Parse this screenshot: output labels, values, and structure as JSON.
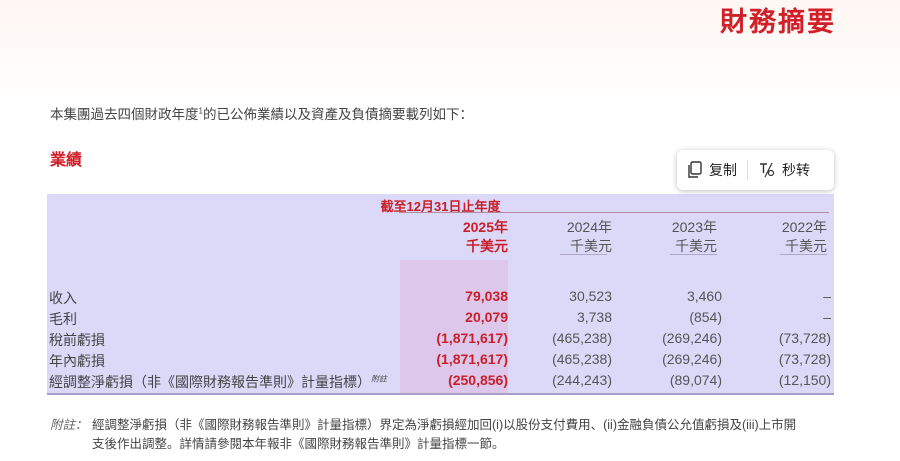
{
  "header": {
    "title": "財務摘要"
  },
  "intro": {
    "text_before": "本集團過去四個財政年度",
    "sup": "1",
    "text_after": "的已公佈業績以及資產及負債摘要載列如下："
  },
  "section": {
    "title": "業績"
  },
  "toolbar": {
    "copy_label": "复制",
    "convert_label": "秒转"
  },
  "table": {
    "period_header": "截至12月31日止年度",
    "columns": [
      {
        "year": "2025年",
        "unit": "千美元"
      },
      {
        "year": "2024年",
        "unit": "千美元"
      },
      {
        "year": "2023年",
        "unit": "千美元"
      },
      {
        "year": "2022年",
        "unit": "千美元"
      }
    ],
    "rows": [
      {
        "label": "收入",
        "values": [
          "79,038",
          "30,523",
          "3,460",
          "–"
        ]
      },
      {
        "label": "毛利",
        "values": [
          "20,079",
          "3,738",
          "(854)",
          "–"
        ]
      },
      {
        "label": "稅前虧損",
        "values": [
          "(1,871,617)",
          "(465,238)",
          "(269,246)",
          "(73,728)"
        ]
      },
      {
        "label": "年內虧損",
        "values": [
          "(1,871,617)",
          "(465,238)",
          "(269,246)",
          "(73,728)"
        ]
      },
      {
        "label": "經調整淨虧損（非《國際財務報告準則》計量指標）",
        "label_sup": "附註",
        "values": [
          "(250,856)",
          "(244,243)",
          "(89,074)",
          "(12,150)"
        ]
      }
    ]
  },
  "note": {
    "label": "附註：",
    "line1": "經調整淨虧損（非《國際財務報告準則》計量指標）界定為淨虧損經加回(i)以股份支付費用、(ii)金融負債公允值虧損及(iii)上市開",
    "line2": "支後作出調整。詳情請參閱本年報非《國際財務報告準則》計量指標一節。"
  }
}
